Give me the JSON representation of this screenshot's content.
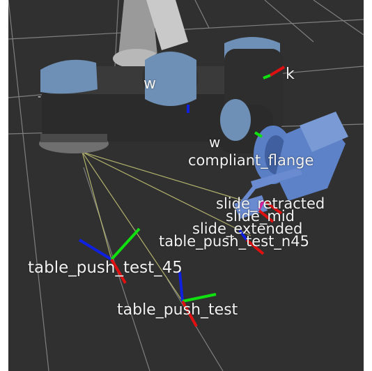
{
  "scene": {
    "background": "#303030",
    "grid_color": "#9a9a9a",
    "axis_colors": {
      "x": "#e01010",
      "y": "#10e010",
      "z": "#1020e0"
    },
    "link_line_color": "#c8c878",
    "robot_colors": {
      "body": "#2b2b2b",
      "cap": "#6e90b6",
      "flange": "#6f6f6f",
      "gripper": "#5d82c8"
    }
  },
  "frame_labels": {
    "upper_link": "k",
    "wrist_upper": "w",
    "wrist": "w",
    "left_edge": "-",
    "compliant_flange": "compliant_flange",
    "slide_retracted": "slide_retracted",
    "slide_mid": "slide_mid",
    "slide_extended": "slide_extended",
    "table_push_test_n45": "table_push_test_n45",
    "table_push_test_45": "table_push_test_45",
    "table_push_test": "table_push_test"
  }
}
